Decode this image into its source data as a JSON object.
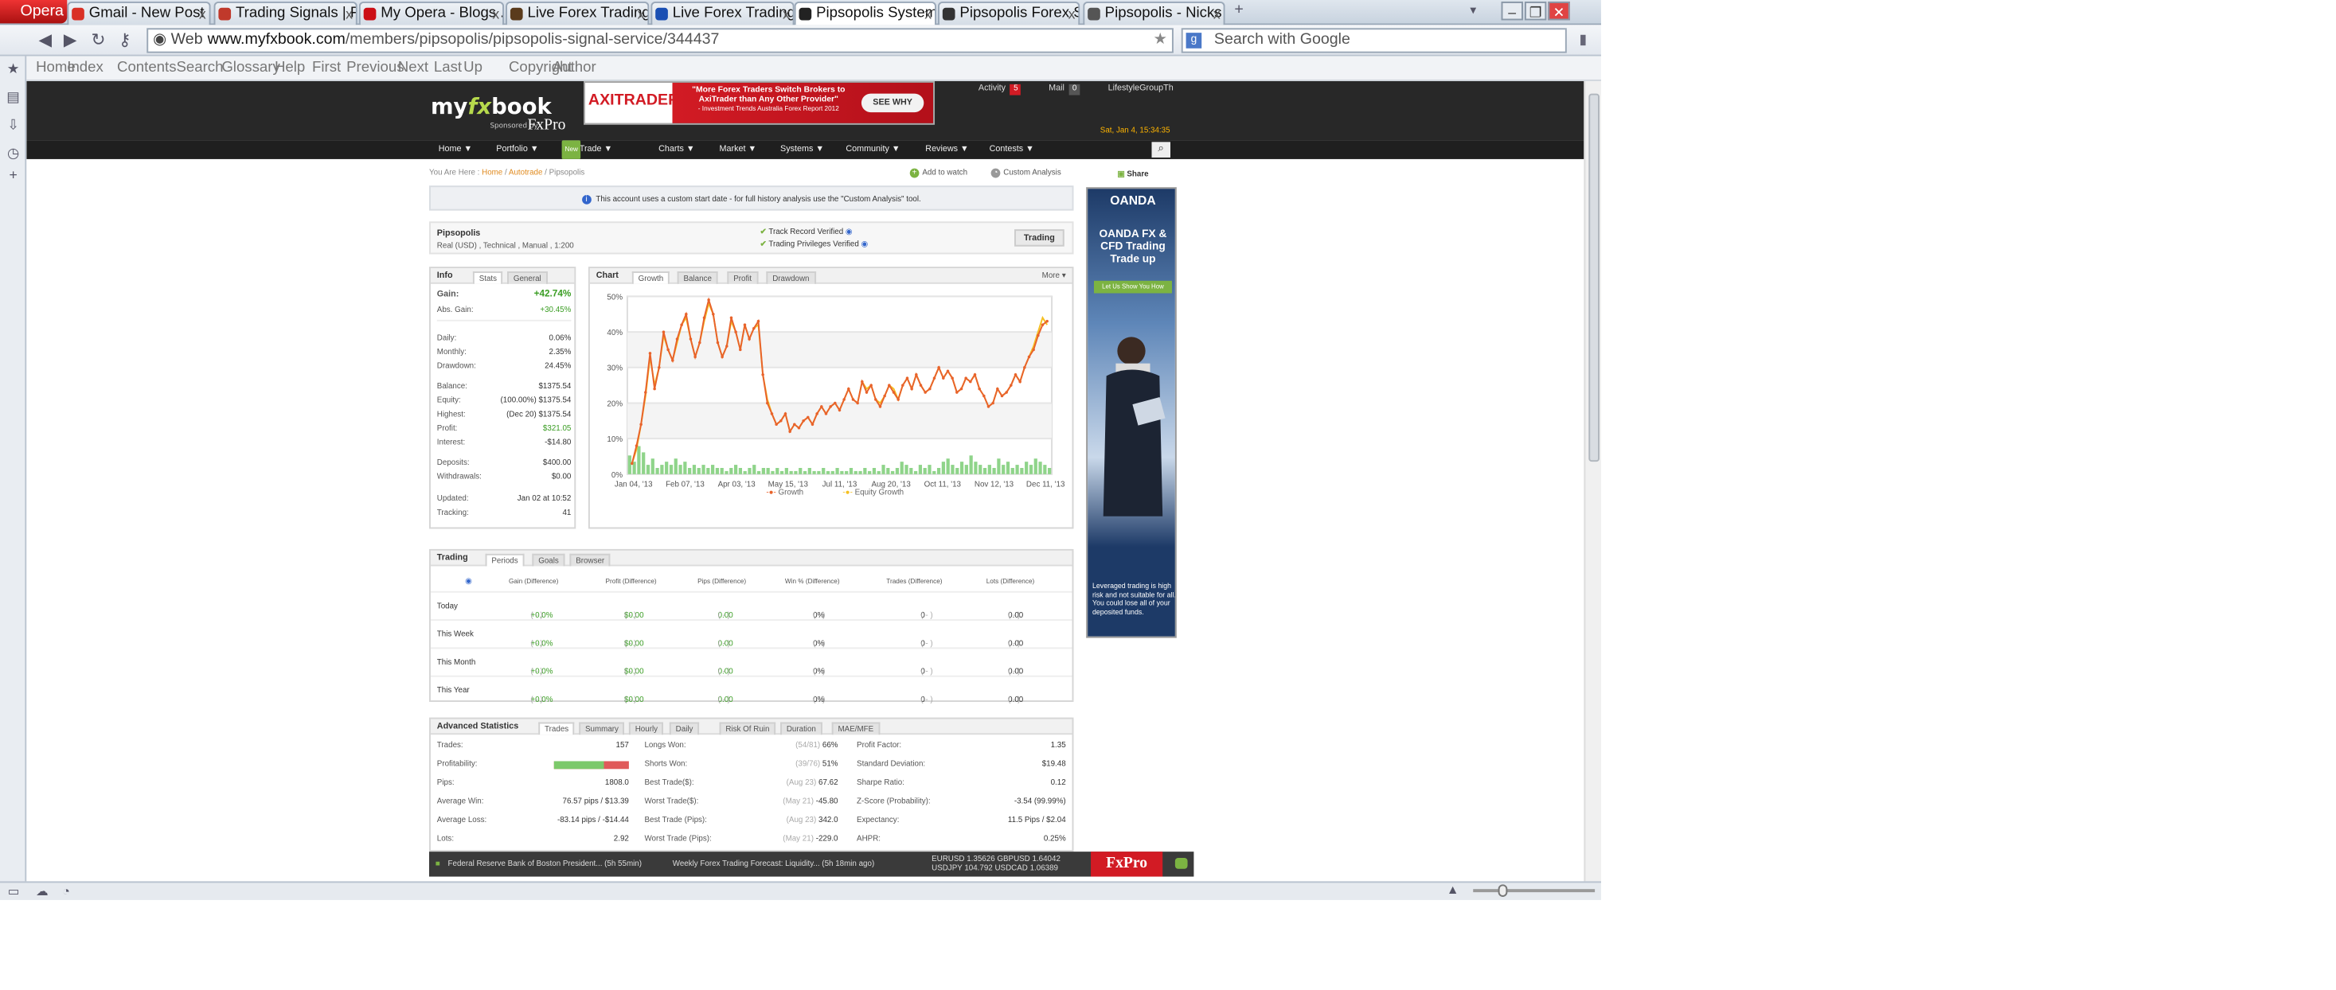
{
  "browser": {
    "opera_label": "Opera",
    "tabs": [
      {
        "label": "Gmail - New Post I...",
        "color": "#d93025"
      },
      {
        "label": "Trading Signals | F...",
        "color": "#c0392b"
      },
      {
        "label": "My Opera - Blogs ...",
        "color": "#cc0f16"
      },
      {
        "label": "Live Forex Trading...",
        "color": "#5a3b1c"
      },
      {
        "label": "Live Forex Trading...",
        "color": "#1a4fb3"
      },
      {
        "label": "Pipsopolis System ...",
        "color": "#222222"
      },
      {
        "label": "Pipsopolis Forex S...",
        "color": "#333333"
      },
      {
        "label": "Pipsopolis - Nicks ...",
        "color": "#555555"
      }
    ],
    "url_mode": "Web",
    "url_domain": "www.myfxbook.com",
    "url_path": "/members/pipsopolis/pipsopolis-signal-service/344437",
    "search_placeholder": "Search with Google",
    "nav_links": [
      "Home",
      "Index",
      "Contents",
      "Search",
      "Glossary",
      "Help",
      "First",
      "Previous",
      "Next",
      "Last",
      "Up",
      "Copyright",
      "Author"
    ]
  },
  "site": {
    "logo_my": "my",
    "logo_fx": "fx",
    "logo_book": "book",
    "sponsored": "Sponsored by",
    "sponsor": "FxPro",
    "banner_brand": "AXITRADER",
    "banner_msg": "\"More Forex Traders Switch Brokers to AxiTrader than Any Other Provider\"",
    "banner_src": "- Investment Trends Australia Forex Report 2012",
    "banner_cta": "SEE WHY",
    "activity_label": "Activity",
    "activity_count": "5",
    "mail_label": "Mail",
    "mail_count": "0",
    "user": "LifestyleGroupTh",
    "date": "Sat, Jan 4, 15:34:35",
    "menu": [
      "Home ▼",
      "Portfolio ▼",
      "AutoTrade ▼",
      "Charts ▼",
      "Market ▼",
      "Systems ▼",
      "Community ▼",
      "Reviews ▼",
      "Contests ▼"
    ],
    "menu_new": "New"
  },
  "page": {
    "you_are_here": "You Are Here :",
    "crumb_home": "Home",
    "crumb_auto": "Autotrade",
    "crumb_current": "Pipsopolis",
    "add_watch": "Add to watch",
    "custom_analysis": "Custom Analysis",
    "share": "Share",
    "notice": "This account uses a custom start date - for full history analysis use the \"Custom Analysis\" tool.",
    "account_name": "Pipsopolis",
    "account_meta": "Real (USD) , Technical , Manual , 1:200",
    "track_record": "Track Record  Verified",
    "trading_priv": "Trading Privileges Verified",
    "trading_btn": "Trading"
  },
  "info": {
    "header": "Info",
    "tabs": [
      "Stats",
      "General"
    ],
    "gain_label": "Gain:",
    "gain": "+42.74%",
    "abs_gain_label": "Abs. Gain:",
    "abs_gain": "+30.45%",
    "rows1": [
      {
        "k": "Daily:",
        "v": "0.06%"
      },
      {
        "k": "Monthly:",
        "v": "2.35%"
      },
      {
        "k": "Drawdown:",
        "v": "24.45%"
      }
    ],
    "rows2": [
      {
        "k": "Balance:",
        "v": "$1375.54"
      },
      {
        "k": "Equity:",
        "v": "(100.00%) $1375.54"
      },
      {
        "k": "Highest:",
        "v": "(Dec 20) $1375.54"
      },
      {
        "k": "Profit:",
        "v": "$321.05"
      },
      {
        "k": "Interest:",
        "v": "-$14.80"
      }
    ],
    "rows3": [
      {
        "k": "Deposits:",
        "v": "$400.00"
      },
      {
        "k": "Withdrawals:",
        "v": "$0.00"
      }
    ],
    "rows4": [
      {
        "k": "Updated:",
        "v": "Jan 02 at 10:52"
      },
      {
        "k": "Tracking:",
        "v": "41"
      }
    ]
  },
  "chart_panel": {
    "header": "Chart",
    "tabs": [
      "Growth",
      "Balance",
      "Profit",
      "Drawdown"
    ],
    "more": "More",
    "legend_growth": "Growth",
    "legend_equity": "Equity Growth",
    "growth_color": "#e8632b",
    "equity_color": "#f5c022",
    "bar_color": "#8fd48a"
  },
  "chart_data": {
    "type": "line",
    "title": "",
    "ylabel": "",
    "ylim": [
      0,
      50
    ],
    "yticks": [
      "0%",
      "10%",
      "20%",
      "30%",
      "40%",
      "50%"
    ],
    "xticks": [
      "Jan 04, '13",
      "Feb 07, '13",
      "Apr 03, '13",
      "May 15, '13",
      "Jul 11, '13",
      "Aug 20, '13",
      "Oct 11, '13",
      "Nov 12, '13",
      "Dec 11, '13"
    ],
    "series": [
      {
        "name": "Growth",
        "values": [
          3,
          8,
          14,
          23,
          34,
          24,
          30,
          40,
          35,
          32,
          38,
          42,
          45,
          38,
          33,
          37,
          44,
          49,
          45,
          37,
          33,
          36,
          44,
          40,
          35,
          42,
          38,
          41,
          43,
          28,
          20,
          17,
          14,
          15,
          17,
          12,
          14,
          13,
          15,
          16,
          14,
          17,
          19,
          17,
          19,
          20,
          18,
          21,
          24,
          21,
          20,
          26,
          23,
          25,
          21,
          19,
          22,
          25,
          23,
          21,
          25,
          27,
          24,
          28,
          25,
          23,
          24,
          27,
          30,
          27,
          29,
          27,
          23,
          24,
          27,
          26,
          28,
          24,
          22,
          19,
          20,
          24,
          22,
          23,
          25,
          28,
          26,
          30,
          33,
          35,
          39,
          42,
          43
        ]
      },
      {
        "name": "Equity Growth",
        "values": [
          3,
          7,
          14,
          22,
          33,
          25,
          30,
          39,
          35,
          32,
          37,
          42,
          44,
          38,
          33,
          37,
          43,
          48,
          45,
          37,
          33,
          36,
          43,
          40,
          35,
          42,
          38,
          41,
          42,
          28,
          21,
          17,
          14,
          15,
          17,
          12,
          14,
          13,
          15,
          16,
          14,
          17,
          19,
          17,
          19,
          20,
          18,
          21,
          24,
          21,
          20,
          26,
          24,
          25,
          21,
          20,
          22,
          25,
          24,
          21,
          25,
          27,
          24,
          28,
          25,
          23,
          24,
          27,
          30,
          27,
          29,
          27,
          23,
          24,
          27,
          26,
          28,
          24,
          22,
          19,
          20,
          24,
          22,
          23,
          25,
          28,
          26,
          30,
          33,
          36,
          40,
          44,
          42
        ]
      }
    ],
    "bars": [
      6,
      4,
      9,
      7,
      3,
      5,
      2,
      3,
      4,
      3,
      5,
      3,
      4,
      2,
      3,
      2,
      3,
      2,
      3,
      2,
      2,
      1,
      2,
      3,
      2,
      1,
      2,
      3,
      1,
      2,
      2,
      1,
      2,
      1,
      2,
      1,
      1,
      2,
      1,
      2,
      1,
      1,
      2,
      1,
      1,
      2,
      1,
      1,
      2,
      1,
      1,
      2,
      1,
      2,
      1,
      3,
      2,
      1,
      2,
      4,
      3,
      2,
      1,
      3,
      2,
      3,
      1,
      2,
      4,
      5,
      3,
      2,
      4,
      3,
      6,
      4,
      3,
      2,
      3,
      2,
      5,
      3,
      4,
      2,
      3,
      2,
      4,
      3,
      5,
      4,
      3,
      2
    ]
  },
  "trading": {
    "header": "Trading",
    "tabs": [
      "Periods",
      "Goals",
      "Browser"
    ],
    "columns": [
      "Gain (Difference)",
      "Profit (Difference)",
      "Pips (Difference)",
      "Win % (Difference)",
      "Trades (Difference)",
      "Lots (Difference)"
    ],
    "rows": [
      {
        "period": "Today",
        "gain": "+0.0%",
        "profit": "$0.00",
        "pips": "0.00",
        "win": "0%",
        "trades": "0",
        "lots": "0.00",
        "diff": "( - )"
      },
      {
        "period": "This Week",
        "gain": "+0.0%",
        "profit": "$0.00",
        "pips": "0.00",
        "win": "0%",
        "trades": "0",
        "lots": "0.00",
        "diff": "( - )"
      },
      {
        "period": "This Month",
        "gain": "+0.0%",
        "profit": "$0.00",
        "pips": "0.00",
        "win": "0%",
        "trades": "0",
        "lots": "0.00",
        "diff": "( - )"
      },
      {
        "period": "This Year",
        "gain": "+0.0%",
        "profit": "$0.00",
        "pips": "0.00",
        "win": "0%",
        "trades": "0",
        "lots": "0.00",
        "diff": "( - )"
      }
    ]
  },
  "advanced": {
    "header": "Advanced Statistics",
    "tabs": [
      "Trades",
      "Summary",
      "Hourly",
      "Daily",
      "Risk Of Ruin",
      "Duration",
      "MAE/MFE"
    ],
    "col1": [
      {
        "k": "Trades:",
        "v": "157"
      },
      {
        "k": "Profitability:",
        "v": ""
      },
      {
        "k": "Pips:",
        "v": "1808.0"
      },
      {
        "k": "Average Win:",
        "v": "76.57 pips / $13.39"
      },
      {
        "k": "Average Loss:",
        "v": "-83.14 pips / -$14.44"
      },
      {
        "k": "Lots:",
        "v": "2.92"
      }
    ],
    "profitability": 0.66,
    "col2": [
      {
        "k": "Longs Won:",
        "d": "(54/81)",
        "v": "66%"
      },
      {
        "k": "Shorts Won:",
        "d": "(39/76)",
        "v": "51%"
      },
      {
        "k": "Best Trade($):",
        "d": "(Aug 23)",
        "v": "67.62"
      },
      {
        "k": "Worst Trade($):",
        "d": "(May 21)",
        "v": "-45.80"
      },
      {
        "k": "Best Trade (Pips):",
        "d": "(Aug 23)",
        "v": "342.0"
      },
      {
        "k": "Worst Trade (Pips):",
        "d": "(May 21)",
        "v": "-229.0"
      }
    ],
    "col3": [
      {
        "k": "Profit Factor:",
        "v": "1.35"
      },
      {
        "k": "Standard Deviation:",
        "v": "$19.48"
      },
      {
        "k": "Sharpe Ratio:",
        "v": "0.12"
      },
      {
        "k": "Z-Score (Probability):",
        "v": "-3.54 (99.99%)"
      },
      {
        "k": "Expectancy:",
        "v": "11.5 Pips / $2.04"
      },
      {
        "k": "AHPR:",
        "v": "0.25%"
      }
    ]
  },
  "ad": {
    "brand": "OANDA",
    "tagline": "OANDA FX & CFD Trading Trade up",
    "cta": "Let Us Show You How",
    "disclaimer": "Leveraged trading is high risk and not suitable for all. You could lose all of your deposited funds."
  },
  "ticker": {
    "news1": "Federal Reserve Bank of Boston President... (5h 55min)",
    "news2": "Weekly Forex Trading Forecast: Liquidity... (5h 18min ago)",
    "q1": "EURUSD   1.35626    GBPUSD   1.64042",
    "q2": "USDJPY   104.792    USDCAD   1.06389",
    "brand": "FxPro"
  }
}
